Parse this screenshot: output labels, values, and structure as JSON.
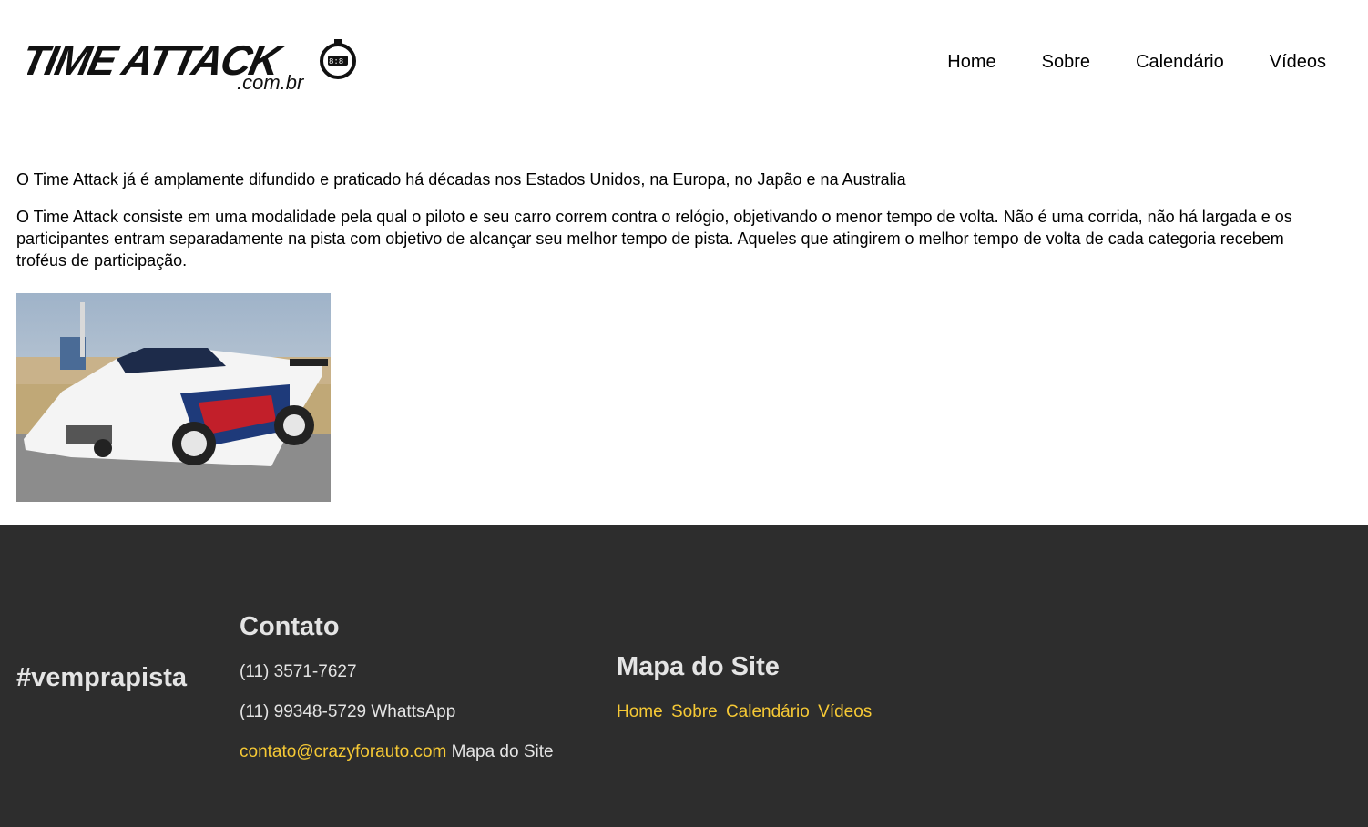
{
  "header": {
    "logo_text": "TIME ATTACK",
    "logo_sub": ".com.br",
    "nav": [
      "Home",
      "Sobre",
      "Calendário",
      "Vídeos"
    ]
  },
  "content": {
    "paragraph1": "O Time Attack já é amplamente difundido e praticado há décadas nos Estados Unidos, na Europa, no Japão e na Australia",
    "paragraph2": "O Time Attack consiste em uma modalidade pela qual o piloto e seu carro correm contra o relógio, objetivando o menor tempo de volta. Não é uma corrida, não há largada e os participantes entram separadamente na pista com objetivo de alcançar seu melhor tempo de pista. Aqueles que atingirem o melhor tempo de volta de cada categoria recebem troféus de participação."
  },
  "footer": {
    "tagline": "#vemprapista",
    "contato": {
      "title": "Contato",
      "phone1": "(11) 3571-7627",
      "phone2": "(11) 99348-5729 WhattsApp",
      "email": "contato@crazyforauto.com",
      "email_suffix": "Mapa do Site"
    },
    "mapa": {
      "title": "Mapa do Site",
      "links": [
        "Home",
        "Sobre",
        "Calendário",
        "Vídeos"
      ]
    }
  },
  "colors": {
    "footer_bg": "#2d2d2d",
    "footer_text": "#e4e4e4",
    "link_accent": "#f6c935"
  }
}
